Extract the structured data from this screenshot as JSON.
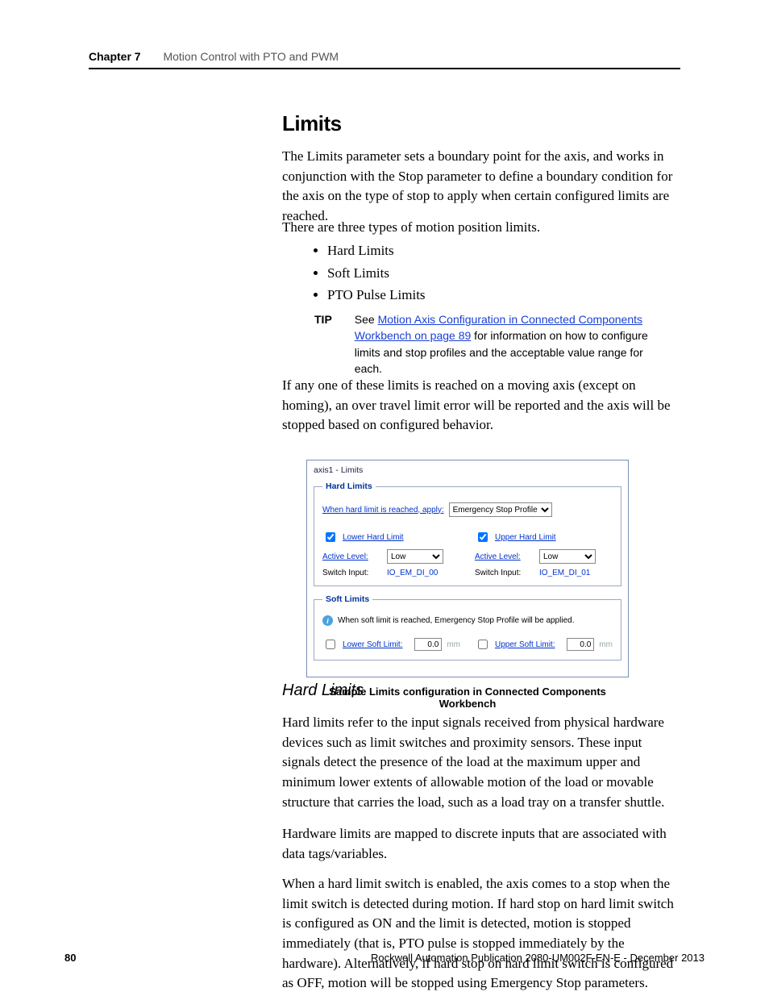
{
  "header": {
    "chapter": "Chapter 7",
    "title": "Motion Control with PTO and PWM"
  },
  "h_limits": "Limits",
  "p1": "The Limits parameter sets a  boundary point for the axis, and works in conjunction with the Stop parameter to define a boundary condition for the axis on the type of stop to apply when certain configured limits are reached.",
  "p2": "There are three types of motion position limits.",
  "bullets": {
    "b1": "Hard Limits",
    "b2": "Soft Limits",
    "b3": "PTO Pulse Limits"
  },
  "tip": {
    "label": "TIP",
    "pre": "See ",
    "link": "Motion Axis Configuration in Connected Components Workbench on page 89",
    "post": " for information on how to configure limits and stop profiles and the acceptable value range for each."
  },
  "p3": "If any one of these limits is reached on a moving axis (except on homing), an over travel limit error will be reported and the axis will be stopped based on configured behavior.",
  "shot": {
    "window_title": "axis1 - Limits",
    "hard": {
      "legend": "Hard Limits",
      "whenlabel": "When hard limit is reached, apply:",
      "whenvalue": "Emergency Stop Profile",
      "lower": {
        "chk": "Lower Hard Limit",
        "active_k": "Active Level:",
        "active_v": "Low",
        "switch_k": "Switch Input:",
        "switch_v": "IO_EM_DI_00"
      },
      "upper": {
        "chk": "Upper Hard Limit",
        "active_k": "Active Level:",
        "active_v": "Low",
        "switch_k": "Switch Input:",
        "switch_v": "IO_EM_DI_01"
      }
    },
    "soft": {
      "legend": "Soft Limits",
      "info": "When soft limit is reached, Emergency Stop Profile will be applied.",
      "lower": {
        "chk": "Lower Soft Limit:",
        "val": "0.0",
        "unit": "mm"
      },
      "upper": {
        "chk": "Upper Soft Limit:",
        "val": "0.0",
        "unit": "mm"
      }
    }
  },
  "caption": "Sample Limits configuration in Connected Components Workbench",
  "h_hardlimits": "Hard Limits",
  "p4": "Hard limits refer to the input signals received from physical hardware devices such as limit switches and proximity sensors. These input signals detect the presence of the load at the maximum upper and minimum lower extents of allowable motion of the load or movable structure that carries the load, such as a load tray on a transfer shuttle.",
  "p5": "Hardware limits are mapped to discrete inputs that are associated with data tags/variables.",
  "p6": "When a hard limit switch is enabled, the axis comes to a stop when the limit switch is detected during motion. If hard stop on hard limit switch is configured as ON and the limit is detected, motion is stopped immediately (that is, PTO pulse is stopped immediately by the hardware). Alternatively, if hard stop on hard limit switch is configured as OFF, motion will be stopped using Emergency Stop parameters.",
  "footer": {
    "page": "80",
    "pub": "Rockwell Automation Publication 2080-UM002F-EN-E - December 2013"
  }
}
